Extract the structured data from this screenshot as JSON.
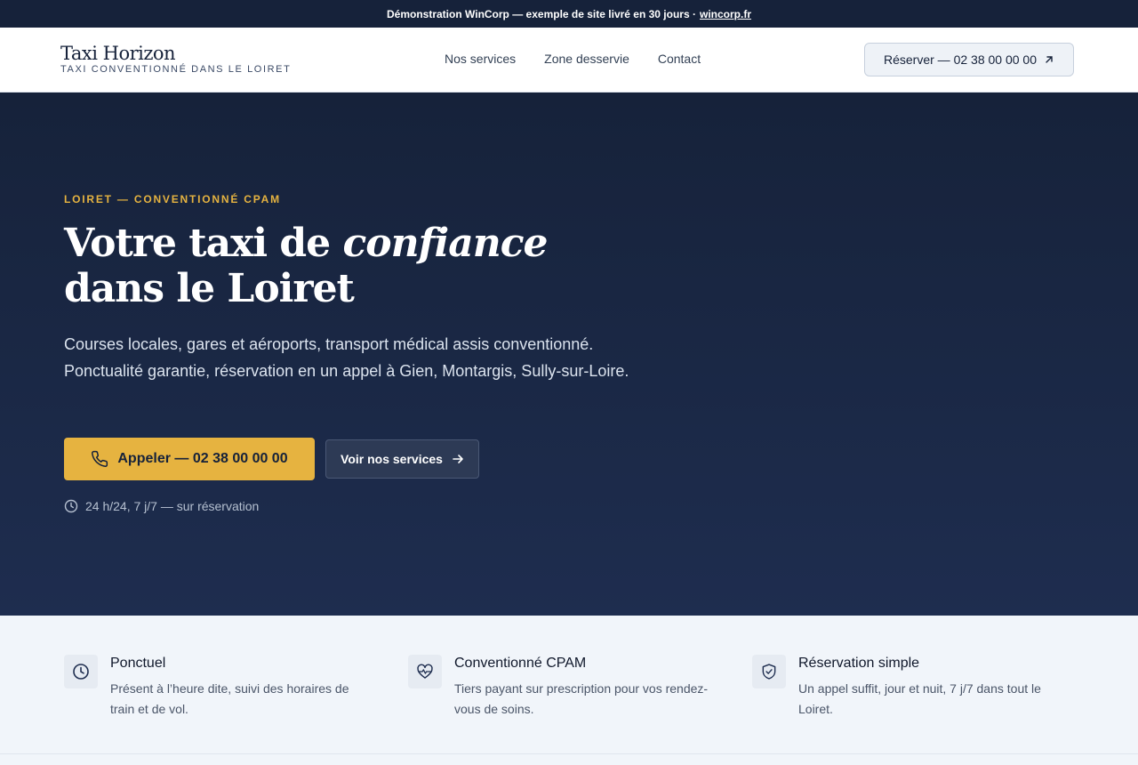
{
  "topbar": {
    "text": "Démonstration WinCorp — exemple de site livré en 30 jours ·",
    "link": "wincorp.fr"
  },
  "header": {
    "brand_name": "Taxi Horizon",
    "brand_tagline": "TAXI CONVENTIONNÉ DANS LE LOIRET",
    "nav": [
      "Nos services",
      "Zone desservie",
      "Contact"
    ],
    "cta_label": "Réserver — 02 38 00 00 00",
    "cta_icon": "arrow-up-right-icon"
  },
  "hero": {
    "eyebrow": "LOIRET — CONVENTIONNÉ CPAM",
    "title_before": "Votre taxi de",
    "title_emphasis": "confiance",
    "title_after": "dans le Loiret",
    "subtitle": "Courses locales, gares et aéroports, transport médical assis conventionné. Ponctualité garantie, réservation en un appel à Gien, Montargis, Sully-sur-Loire.",
    "primary_button": "Appeler — 02 38 00 00 00",
    "primary_icon": "phone-icon",
    "secondary_button": "Voir nos services",
    "secondary_icon": "arrow-right-icon",
    "hours": "24 h/24, 7 j/7 — sur réservation",
    "hours_icon": "clock-icon"
  },
  "features": [
    {
      "icon": "clock-icon",
      "title": "Ponctuel",
      "description": "Présent à l’heure dite, suivi des horaires de train et de vol."
    },
    {
      "icon": "heart-pulse-icon",
      "title": "Conventionné CPAM",
      "description": "Tiers payant sur prescription pour vos rendez-vous de soins."
    },
    {
      "icon": "shield-check-icon",
      "title": "Réservation simple",
      "description": "Un appel suffit, jour et nuit, 7 j/7 dans tout le Loiret."
    }
  ],
  "colors": {
    "navy": "#16223a",
    "accent_gold": "#e6b340",
    "light_bg": "#f1f5fa"
  }
}
